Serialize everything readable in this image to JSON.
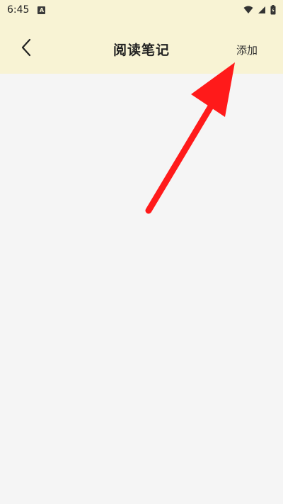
{
  "status_bar": {
    "time": "6:45",
    "notification_icon_glyph": "A",
    "icons": [
      "wifi-icon",
      "signal-icon",
      "battery-icon"
    ]
  },
  "toolbar": {
    "title": "阅读笔记",
    "add_label": "添加",
    "back_icon": "chevron-left-icon"
  },
  "colors": {
    "toolbar_bg": "#f8f3d4",
    "content_bg": "#f5f5f5",
    "annotation_arrow": "#ff1a1a"
  }
}
